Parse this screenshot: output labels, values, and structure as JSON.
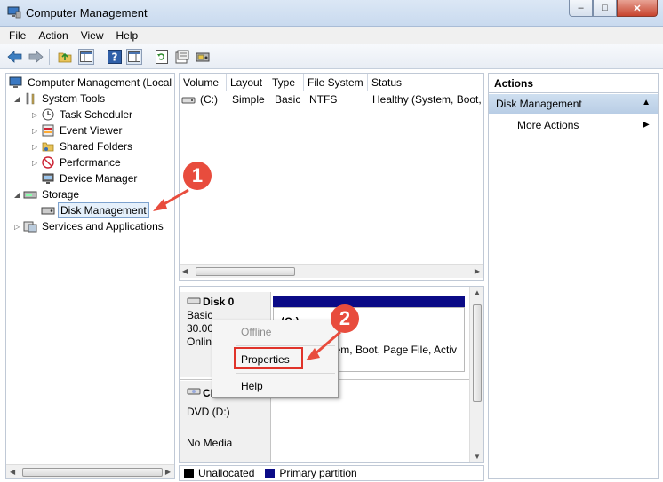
{
  "window": {
    "title": "Computer Management",
    "min": "–",
    "max": "□",
    "close": "✕"
  },
  "menu": [
    "File",
    "Action",
    "View",
    "Help"
  ],
  "tree": {
    "root": "Computer Management (Local",
    "system_tools": "System Tools",
    "task_scheduler": "Task Scheduler",
    "event_viewer": "Event Viewer",
    "shared_folders": "Shared Folders",
    "performance": "Performance",
    "device_manager": "Device Manager",
    "storage": "Storage",
    "disk_management": "Disk Management",
    "services": "Services and Applications"
  },
  "volume_table": {
    "columns": [
      "Volume",
      "Layout",
      "Type",
      "File System",
      "Status"
    ],
    "rows": [
      {
        "volume": "(C:)",
        "layout": "Simple",
        "type": "Basic",
        "fs": "NTFS",
        "status": "Healthy (System, Boot, "
      }
    ]
  },
  "disks": {
    "disk0": {
      "name": "Disk 0",
      "type": "Basic",
      "size": "30.00",
      "state": "Onlin"
    },
    "disk0_partition": {
      "label": "(C:)",
      "status": "tem, Boot, Page File, Activ"
    },
    "cd": {
      "name": "CI",
      "drive": "DVD (D:)",
      "media": "No Media"
    }
  },
  "legend": {
    "unallocated": "Unallocated",
    "primary": "Primary partition",
    "unallocated_color": "#000000",
    "primary_color": "#0a0a86"
  },
  "actions": {
    "header": "Actions",
    "section": "Disk Management",
    "more": "More Actions"
  },
  "context_menu": {
    "offline": "Offline",
    "properties": "Properties",
    "help": "Help"
  },
  "annotations": {
    "step1": "1",
    "step2": "2"
  },
  "colors": {
    "accent_red": "#e84c3d",
    "partition_bar": "#0a0a86"
  }
}
